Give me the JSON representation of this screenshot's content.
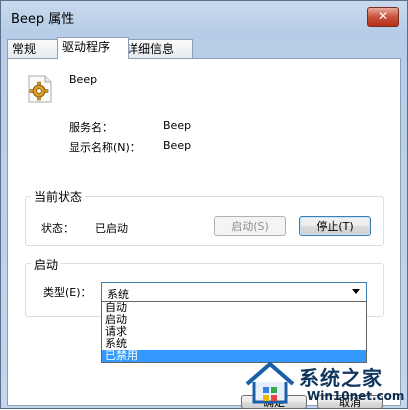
{
  "window": {
    "title": "Beep 属性",
    "close_glyph": "✕"
  },
  "tabs": [
    {
      "label": "常规"
    },
    {
      "label": "驱动程序"
    },
    {
      "label": "详细信息"
    }
  ],
  "driver": {
    "name": "Beep",
    "service_name_label": "服务名：",
    "service_name_value": "Beep",
    "display_name_label": "显示名称(N)：",
    "display_name_value": "Beep"
  },
  "status_group": {
    "title": "当前状态",
    "status_label": "状态：",
    "status_value": "已启动",
    "start_button": "启动(S)",
    "stop_button": "停止(T)"
  },
  "startup_group": {
    "title": "启动",
    "type_label": "类型(E)：",
    "type_value": "系统",
    "options": [
      "自动",
      "启动",
      "请求",
      "系统",
      "已禁用"
    ]
  },
  "bottom_buttons": {
    "ok": "确定",
    "cancel": "取消"
  },
  "watermark": {
    "text": "系统之家",
    "url": "Win10net.com"
  },
  "colors": {
    "selection": "#3399ff",
    "accent": "#3c7fb1"
  },
  "icons": {
    "service": "gear-icon",
    "dropdown": "chevron-down-icon"
  }
}
